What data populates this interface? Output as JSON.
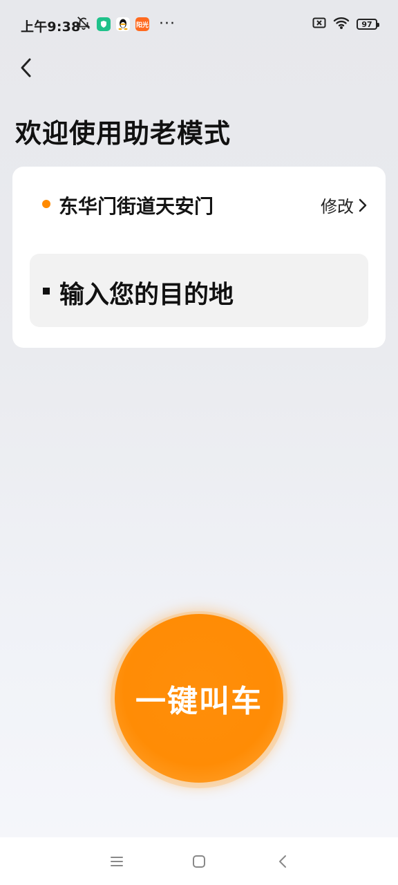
{
  "status_bar": {
    "time": "上午9:38",
    "battery": "97",
    "app_badge_3": "阳光",
    "more": "···"
  },
  "page": {
    "title": "欢迎使用助老模式"
  },
  "card": {
    "origin": "东华门街道天安门",
    "modify_label": "修改",
    "destination_placeholder": "输入您的目的地"
  },
  "action": {
    "call_label": "一键叫车"
  },
  "colors": {
    "accent": "#ff8c05",
    "origin_dot": "#ff8a00"
  }
}
